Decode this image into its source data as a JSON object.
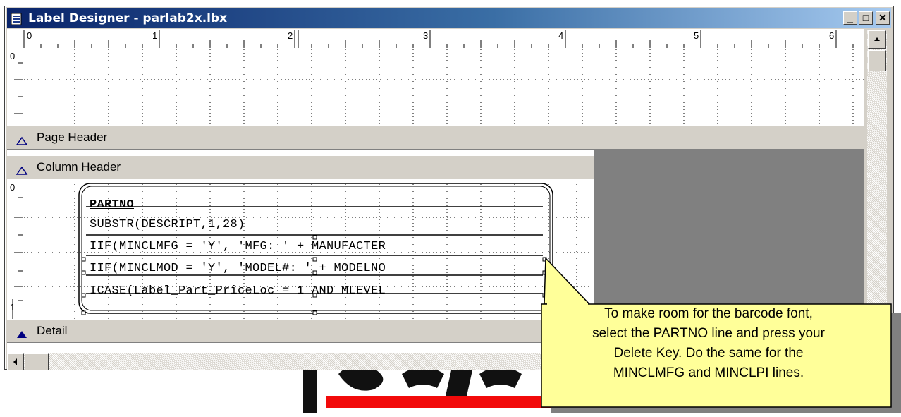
{
  "window": {
    "title": "Label Designer - parlab2x.lbx",
    "buttons": {
      "minimize": "_",
      "maximize": "□",
      "close": "✕"
    }
  },
  "ruler": {
    "top_labels": [
      "0",
      "1",
      "2",
      "3",
      "4",
      "5",
      "6"
    ],
    "left_labels_upper": [
      "0"
    ],
    "left_labels_lower": [
      "0",
      "1"
    ]
  },
  "bands": {
    "page_header": "Page Header",
    "column_header": "Column Header",
    "detail": "Detail"
  },
  "fields": [
    "PARTNO",
    "SUBSTR(DESCRIPT,1,28)",
    "IIF(MINCLMFG = 'Y', 'MFG: ' + MANUFACTER",
    "IIF(MINCLMOD = 'Y', 'MODEL#: ' + MODELNO",
    "ICASE(Label_Part_PriceLoc = 1 AND MLEVEL"
  ],
  "callout": {
    "lines": [
      "To make room for the barcode font,",
      "select the PARTNO line and press your",
      "Delete Key.   Do the same for the",
      "MINCLMFG and MINCLPI lines."
    ]
  },
  "colors": {
    "title_bar": "#0a246a",
    "callout_bg": "#ffff99",
    "logo_red": "#f20a0a"
  }
}
